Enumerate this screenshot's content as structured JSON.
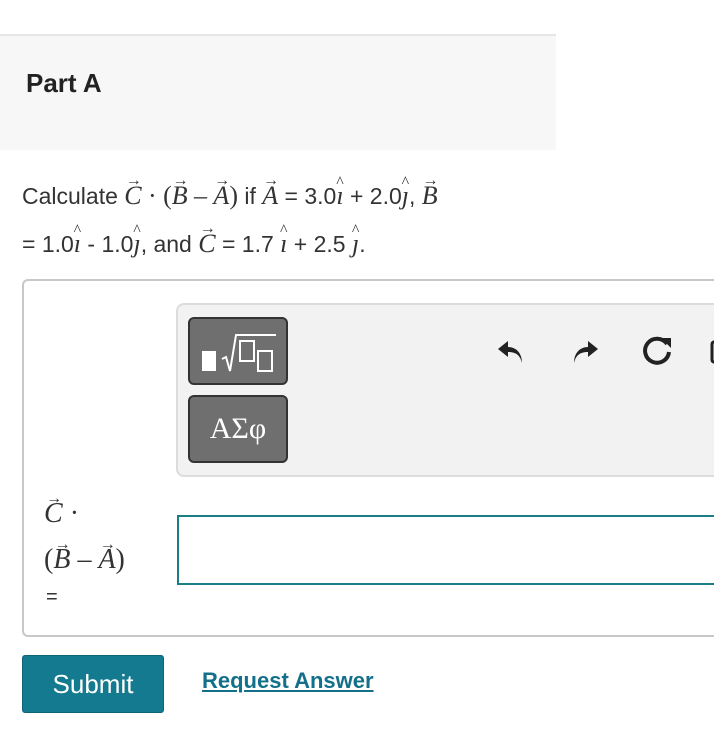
{
  "part": {
    "title": "Part A"
  },
  "question": {
    "calculate": "Calculate",
    "C": "C",
    "B": "B",
    "A": "A",
    "dot": "·",
    "open_paren": "(",
    "minus": "–",
    "close_paren": ")",
    "if": "if",
    "A_value_eq": "= 3.0",
    "A_plus": "+ 2.0",
    "comma": ",",
    "B_value_eq": "= 1.0",
    "B_minus": "- 1.0",
    "and": ", and",
    "C_value_eq": "= 1.7",
    "C_plus": "+ 2.5",
    "period": ".",
    "i": "ı",
    "j": "ȷ"
  },
  "toolbar": {
    "templates_icon": "templates-sqrt-icon",
    "symbols_label": "ΑΣφ",
    "undo_icon": "undo-icon",
    "redo_icon": "redo-icon",
    "reset_icon": "reset-icon",
    "keyboard_icon": "keyboard-icon"
  },
  "answer": {
    "label_C": "C",
    "label_dot": "·",
    "label_open": "(",
    "label_B": "B",
    "label_minus": "–",
    "label_A": "A",
    "label_close": ")",
    "eq": "=",
    "input_value": ""
  },
  "buttons": {
    "submit": "Submit",
    "request_answer": "Request Answer"
  },
  "colors": {
    "accent": "#147a8f",
    "input_border": "#1b7d86",
    "header_bg": "#f7f7f7"
  }
}
